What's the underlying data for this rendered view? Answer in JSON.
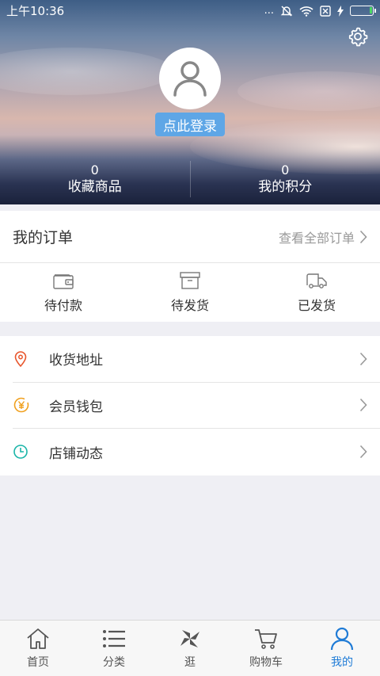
{
  "status_bar": {
    "time": "上午10:36",
    "dots": "..."
  },
  "header": {
    "login_label": "点此登录",
    "stats": [
      {
        "value": "0",
        "label": "收藏商品"
      },
      {
        "value": "0",
        "label": "我的积分"
      }
    ]
  },
  "orders": {
    "title": "我的订单",
    "view_all": "查看全部订单",
    "types": [
      {
        "label": "待付款",
        "icon": "wallet-icon"
      },
      {
        "label": "待发货",
        "icon": "box-icon"
      },
      {
        "label": "已发货",
        "icon": "truck-icon"
      }
    ]
  },
  "menu": [
    {
      "label": "收货地址",
      "icon": "location-pin-icon",
      "color": "#e8542a"
    },
    {
      "label": "会员钱包",
      "icon": "yen-coin-icon",
      "color": "#f0a01e"
    },
    {
      "label": "店铺动态",
      "icon": "clock-icon",
      "color": "#19b5a8"
    }
  ],
  "tabbar": [
    {
      "label": "首页",
      "icon": "home-icon"
    },
    {
      "label": "分类",
      "icon": "list-icon"
    },
    {
      "label": "逛",
      "icon": "pinwheel-icon"
    },
    {
      "label": "购物车",
      "icon": "cart-icon"
    },
    {
      "label": "我的",
      "icon": "user-icon",
      "active": true
    }
  ],
  "colors": {
    "accent": "#1f7bd6",
    "login_button": "#5ea6e6"
  }
}
